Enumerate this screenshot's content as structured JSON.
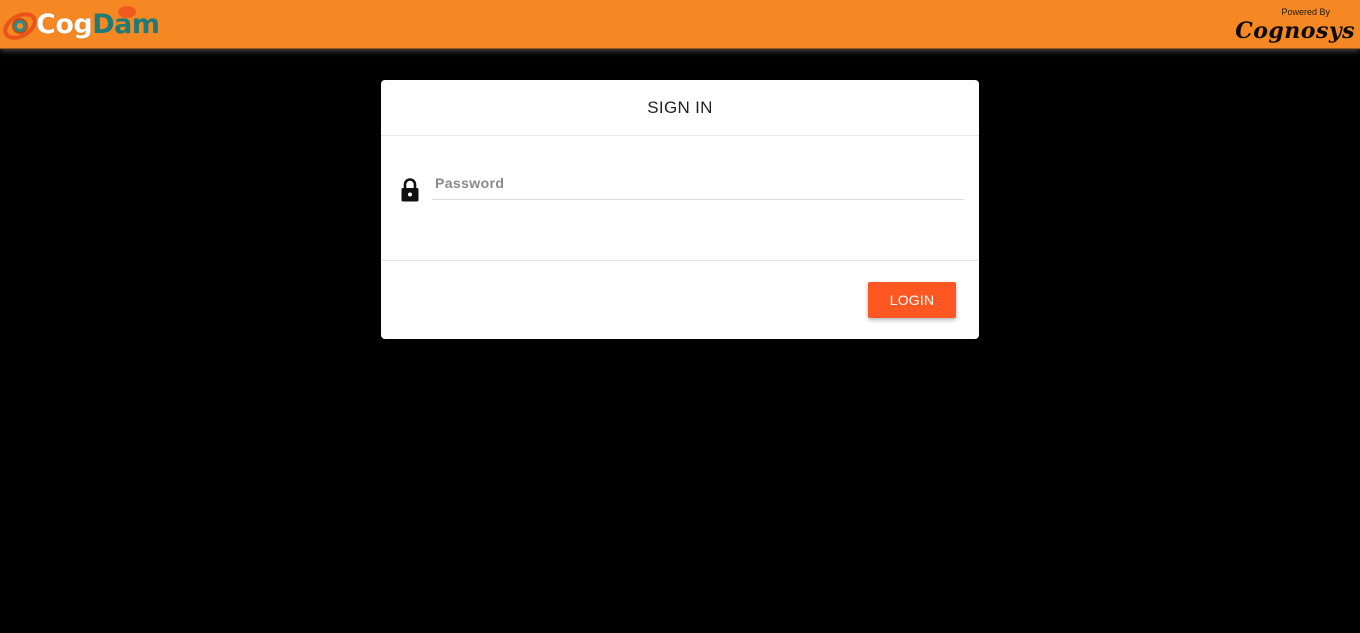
{
  "header": {
    "logo": {
      "text_part1": "Cog",
      "text_part2": "Dam",
      "icon": "logo-cog-icon"
    },
    "powered_by_label": "Powered By",
    "powered_by_brand": "Cognosys"
  },
  "signin": {
    "title": "SIGN IN",
    "password": {
      "placeholder": "Password",
      "value": "",
      "icon": "lock-icon"
    },
    "login_button_label": "LOGIN"
  },
  "colors": {
    "header_bg": "#f68823",
    "page_bg": "#000000",
    "button_bg": "#ff5722",
    "logo_accent": "#1f7a78"
  }
}
